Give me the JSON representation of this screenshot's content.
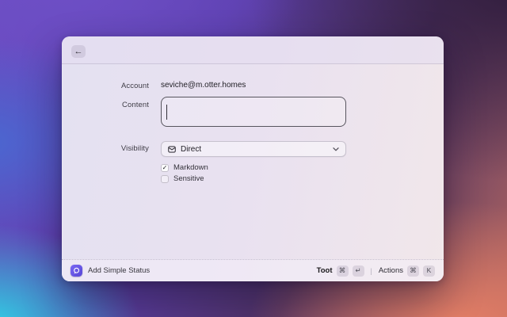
{
  "window": {
    "back_icon": "←",
    "form": {
      "account": {
        "label": "Account",
        "value": "seviche@m.otter.homes"
      },
      "content": {
        "label": "Content",
        "value": ""
      },
      "visibility": {
        "label": "Visibility",
        "value": "Direct",
        "icon": "envelope-icon"
      },
      "markdown": {
        "label": "Markdown",
        "checked": true,
        "check_glyph": "✓"
      },
      "sensitive": {
        "label": "Sensitive",
        "checked": false
      }
    }
  },
  "footer": {
    "app_label": "Add Simple Status",
    "app_icon": "speech-bubble-icon",
    "divider": "|",
    "toot": {
      "label": "Toot",
      "keys": [
        "⌘",
        "↵"
      ]
    },
    "actions": {
      "label": "Actions",
      "keys": [
        "⌘",
        "K"
      ]
    }
  },
  "colors": {
    "accent_purple": "#6454e4",
    "window_tint_left": "#e4e1f1",
    "window_tint_right": "#f1e7ea",
    "wallpaper_purple": "#6a4cc2",
    "wallpaper_blue": "#4969d2",
    "wallpaper_cyan": "#2fd2e5",
    "wallpaper_salmon": "#e78066",
    "wallpaper_dark": "#301d3e"
  }
}
